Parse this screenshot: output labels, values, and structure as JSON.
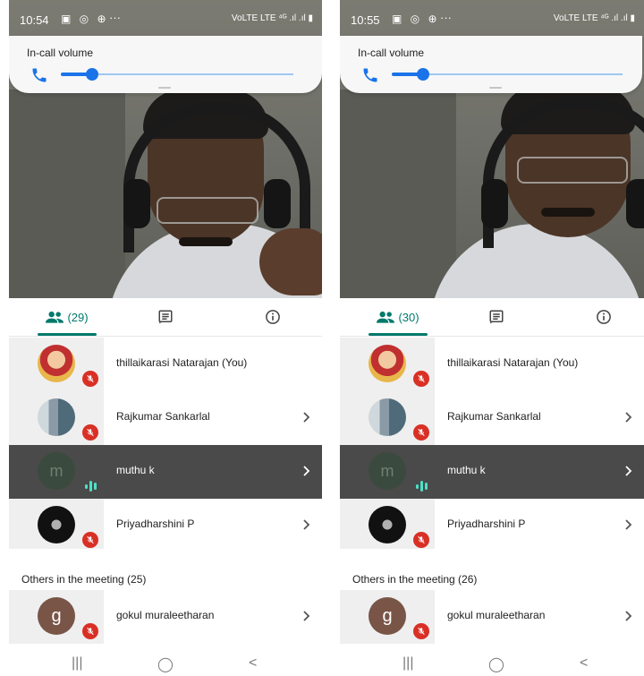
{
  "screens": [
    {
      "status": {
        "time": "10:54",
        "icons": "▣ ◎ ⊕",
        "more": "···",
        "network": "VoLTE LTE ⁴ᴳ .ıl .ıl ▮"
      },
      "volume": {
        "title": "In-call volume",
        "level_percent": 12
      },
      "tabs": {
        "people_count": "(29)"
      },
      "participants": [
        {
          "name": "thillaikarasi Natarajan (You)",
          "state": "muted",
          "avatar": "photo-woman"
        },
        {
          "name": "Rajkumar Sankarlal",
          "state": "muted",
          "avatar": "photo-building"
        },
        {
          "name": "muthu k",
          "state": "speaking",
          "avatar": "letter",
          "initial": "m"
        },
        {
          "name": "Priyadharshini P",
          "state": "muted",
          "avatar": "photo-dark"
        }
      ],
      "others_label": "Others in the meeting (25)",
      "others_first": {
        "name": "gokul muraleetharan",
        "initial": "g",
        "state": "muted"
      }
    },
    {
      "status": {
        "time": "10:55",
        "icons": "▣ ◎ ⊕",
        "more": "···",
        "network": "VoLTE LTE ⁴ᴳ .ıl .ıl ▮"
      },
      "volume": {
        "title": "In-call volume",
        "level_percent": 12
      },
      "tabs": {
        "people_count": "(30)"
      },
      "participants": [
        {
          "name": "thillaikarasi Natarajan (You)",
          "state": "muted",
          "avatar": "photo-woman"
        },
        {
          "name": "Rajkumar Sankarlal",
          "state": "muted",
          "avatar": "photo-building"
        },
        {
          "name": "muthu k",
          "state": "speaking",
          "avatar": "letter",
          "initial": "m"
        },
        {
          "name": "Priyadharshini P",
          "state": "muted",
          "avatar": "photo-dark"
        }
      ],
      "others_label": "Others in the meeting (26)",
      "others_first": {
        "name": "gokul muraleetharan",
        "initial": "g",
        "state": "muted"
      }
    }
  ],
  "colors": {
    "accent": "#00796b",
    "slider": "#1a73e8",
    "muted_badge": "#d93025",
    "speaking": "#4de1c7"
  },
  "navbar": {
    "recent": "|||",
    "home": "◯",
    "back": "<"
  }
}
